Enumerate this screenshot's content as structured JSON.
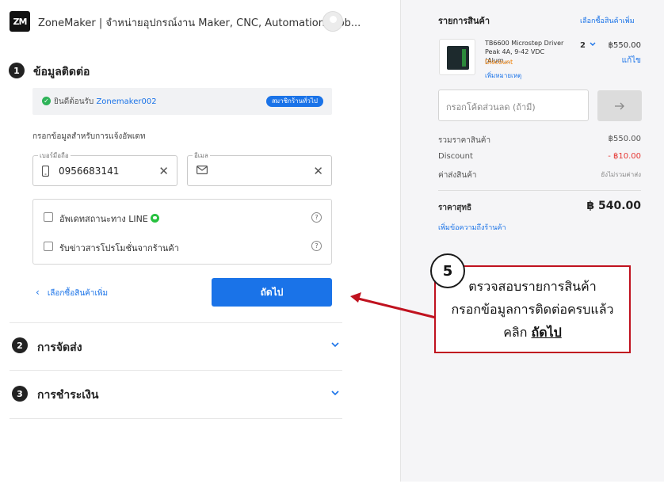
{
  "header": {
    "logo_text": "ZM",
    "store_title": "ZoneMaker | จำหน่ายอุปกรณ์งาน Maker, CNC, Automation, Rob..."
  },
  "steps": [
    {
      "number": "1",
      "title": "ข้อมูลติดต่อ"
    },
    {
      "number": "2",
      "title": "การจัดส่ง"
    },
    {
      "number": "3",
      "title": "การชำระเงิน"
    }
  ],
  "contact": {
    "login_prefix": "ยินดีต้อนรับ",
    "username": "Zonemaker002",
    "member_badge": "สมาชิกร้านทั่วไป",
    "instruction": "กรอกข้อมูลสำหรับการแจ้งอัพเดท",
    "phone_label": "เบอร์มือถือ",
    "phone_value": "0956683141",
    "email_label": "อีเมล",
    "email_value": "",
    "options": [
      {
        "label": "อัพเดทสถานะทาง LINE",
        "checked": false
      },
      {
        "label": "รับข่าวสารโปรโมชั่นจากร้านค้า",
        "checked": false
      }
    ],
    "back_link": "เลือกซื้อสินค้าเพิ่ม",
    "next_button": "ถัดไป"
  },
  "cart": {
    "title": "รายการสินค้า",
    "shop_more": "เลือกซื้อสินค้าเพิ่ม",
    "product": {
      "name": "TB6600 Microstep Driver Peak 4A, 9-42 VDC (Alum...",
      "discount_label": "Discount",
      "add_note": "เพิ่มหมายเหตุ",
      "quantity": "2",
      "price": "฿550.00",
      "edit": "แก้ไข"
    },
    "coupon_placeholder": "กรอกโค้ดส่วนลด (ถ้ามี)",
    "summary": [
      {
        "label": "รวมราคาสินค้า",
        "value": "฿550.00"
      },
      {
        "label": "Discount",
        "value": "- ฿10.00"
      },
      {
        "label": "ค่าส่งสินค้า",
        "value": "ยังไม่รวมค่าส่ง"
      }
    ],
    "total_label": "ราคาสุทธิ",
    "total_value": "฿ 540.00",
    "add_message": "เพิ่มข้อความถึงร้านค้า"
  },
  "annotation": {
    "step": "5",
    "line1": "ตรวจสอบรายการสินค้า",
    "line2": "กรอกข้อมูลการติดต่อครบแล้ว",
    "line3_prefix": "คลิก",
    "line3_emphasis": "ถัดไป"
  },
  "colors": {
    "accent": "#1a73e8",
    "discount_red": "#e53935",
    "annotation_red": "#c0121f"
  }
}
